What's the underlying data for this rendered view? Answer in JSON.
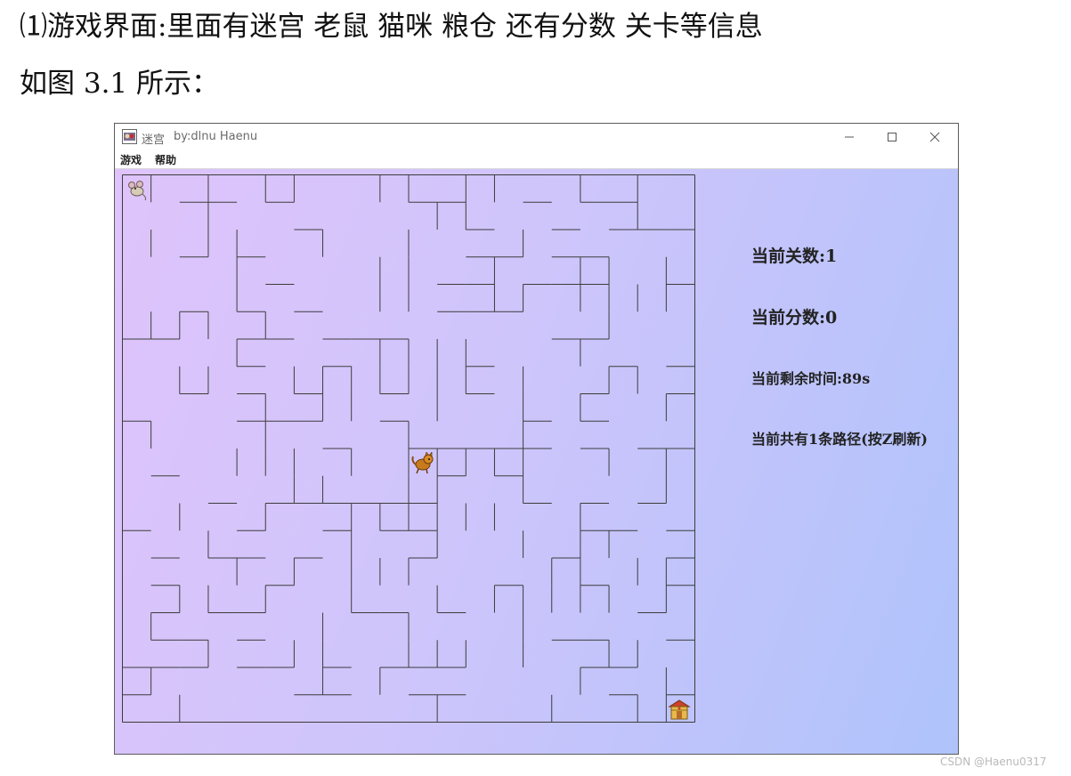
{
  "document": {
    "line1": "⑴游戏界面:里面有迷宫 老鼠 猫咪 粮仓 还有分数 关卡等信息",
    "line2": "如图 3.1 所示："
  },
  "window": {
    "title": "迷宫",
    "author": "by:dlnu Haenu",
    "controls": [
      "minimize-icon",
      "maximize-icon",
      "close-icon"
    ]
  },
  "menu": {
    "game": "游戏",
    "help": "帮助"
  },
  "info": {
    "level_label": "当前关数:",
    "level": "1",
    "score_label": "当前分数:",
    "score": "0",
    "time_label": "当前剩余时间:",
    "time_remaining": "89s",
    "path_label": "当前共有1条路径(按Z刷新)"
  },
  "maze": {
    "rows": 20,
    "cols": 20,
    "sprites": [
      "mouse-sprite",
      "cat-sprite",
      "granary-sprite"
    ]
  },
  "watermark": "CSDN @Haenu0317",
  "colors": {
    "window_gradient_start": "#dfc4fb",
    "window_gradient_end": "#afc3fb",
    "wall": "#3c3c3c"
  }
}
